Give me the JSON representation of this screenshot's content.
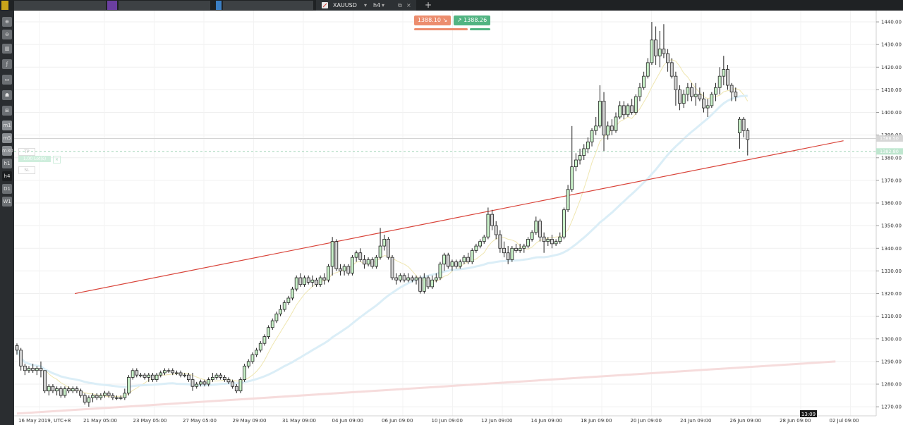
{
  "window": {
    "tab": {
      "symbol": "XAUUSD",
      "timeframe": "h4",
      "new_tab": "+"
    }
  },
  "trade_panel": {
    "sell": {
      "price": "1388.10",
      "arrow": "↘"
    },
    "buy": {
      "price": "1388.26",
      "arrow": "↗"
    }
  },
  "order_lines": {
    "tp_label": "TP",
    "lots_label": "1.00 Lot(s)",
    "sl_label": "SL"
  },
  "toolbar": {
    "buttons": [
      "zoom-in-icon",
      "zoom-out-icon",
      "chart-type-icon",
      "indicator-icon",
      "window-icon",
      "objects-icon",
      "ruler-icon",
      "m1",
      "m5",
      "m30",
      "h1",
      "h4",
      "D1",
      "W1"
    ],
    "active_timeframe": "h4"
  },
  "colors": {
    "bull_body": "#c8f0c8",
    "bear_body": "#d2d2d2",
    "wick": "#222222",
    "trendline": "#d9443a",
    "sell": "#ec8d6e",
    "buy": "#52b482",
    "ma_fast": "#efe6b0",
    "ma_mid": "#dbeef7",
    "ma_slow": "#f6dcdc"
  },
  "chart_data": {
    "type": "candlestick",
    "symbol": "XAUUSD",
    "timeframe": "h4",
    "y_axis": {
      "range": [
        1266,
        1445
      ],
      "ticks": [
        1270,
        1280,
        1290,
        1300,
        1310,
        1320,
        1330,
        1340,
        1350,
        1360,
        1370,
        1380,
        1390,
        1400,
        1410,
        1420,
        1430,
        1440
      ],
      "tick_labels": [
        "1270.00",
        "1280.00",
        "1290.00",
        "1300.00",
        "1310.00",
        "1320.00",
        "1330.00",
        "1340.00",
        "1350.00",
        "1360.00",
        "1370.00",
        "1380.00",
        "1390.00",
        "1400.00",
        "1410.00",
        "1420.00",
        "1430.00",
        "1440.00"
      ]
    },
    "x_axis": {
      "labels": [
        "16 May 2019, UTC+8",
        "21 May 05:00",
        "23 May 05:00",
        "27 May 05:00",
        "29 May 09:00",
        "31 May 09:00",
        "04 Jun 09:00",
        "06 Jun 09:00",
        "10 Jun 09:00",
        "12 Jun 09:00",
        "14 Jun 09:00",
        "18 Jun 09:00",
        "20 Jun 09:00",
        "24 Jun 09:00",
        "26 Jun 09:00",
        "28 Jun 09:00",
        "02 Jul 09:00"
      ],
      "current_time": "13:09"
    },
    "price_markers": {
      "tp_level": 1388.5,
      "current_price": 1382.8,
      "tp_marker_text": "1388.50",
      "current_marker_text": "1382.80"
    },
    "candles": [
      [
        1297.0,
        1298.0,
        1293.0,
        1295.0
      ],
      [
        1295.0,
        1296.0,
        1286.0,
        1288.0
      ],
      [
        1288.0,
        1289.0,
        1284.0,
        1286.0
      ],
      [
        1286.0,
        1288.0,
        1285.0,
        1287.0
      ],
      [
        1287.0,
        1289.0,
        1285.0,
        1286.0
      ],
      [
        1286.0,
        1288.0,
        1284.0,
        1287.0
      ],
      [
        1287.0,
        1290.0,
        1283.0,
        1286.0
      ],
      [
        1286.0,
        1286.0,
        1276.0,
        1277.0
      ],
      [
        1277.0,
        1280.0,
        1275.0,
        1279.0
      ],
      [
        1279.0,
        1280.0,
        1276.0,
        1277.0
      ],
      [
        1277.0,
        1279.0,
        1275.0,
        1278.0
      ],
      [
        1278.0,
        1279.0,
        1274.0,
        1275.0
      ],
      [
        1275.0,
        1279.0,
        1274.0,
        1278.0
      ],
      [
        1278.0,
        1279.0,
        1276.0,
        1277.0
      ],
      [
        1277.0,
        1279.0,
        1276.0,
        1278.0
      ],
      [
        1278.0,
        1279.0,
        1276.0,
        1277.0
      ],
      [
        1277.0,
        1278.0,
        1274.0,
        1275.0
      ],
      [
        1275.0,
        1276.0,
        1271.0,
        1272.0
      ],
      [
        1272.0,
        1275.0,
        1270.0,
        1274.0
      ],
      [
        1274.0,
        1276.0,
        1272.0,
        1275.0
      ],
      [
        1275.0,
        1276.0,
        1273.0,
        1274.0
      ],
      [
        1274.0,
        1276.0,
        1273.0,
        1275.0
      ],
      [
        1275.0,
        1277.0,
        1274.0,
        1276.0
      ],
      [
        1276.0,
        1277.0,
        1274.0,
        1275.0
      ],
      [
        1275.0,
        1276.0,
        1273.0,
        1274.0
      ],
      [
        1274.0,
        1275.0,
        1273.0,
        1274.0
      ],
      [
        1274.0,
        1275.0,
        1273.0,
        1274.0
      ],
      [
        1274.0,
        1278.0,
        1273.0,
        1276.0
      ],
      [
        1276.0,
        1284.0,
        1275.0,
        1283.0
      ],
      [
        1283.0,
        1287.0,
        1282.0,
        1286.0
      ],
      [
        1286.0,
        1287.0,
        1283.0,
        1284.0
      ],
      [
        1284.0,
        1285.0,
        1283.0,
        1284.0
      ],
      [
        1284.0,
        1285.0,
        1282.0,
        1283.0
      ],
      [
        1283.0,
        1285.0,
        1281.0,
        1284.0
      ],
      [
        1284.0,
        1285.0,
        1281.0,
        1282.0
      ],
      [
        1282.0,
        1285.0,
        1281.0,
        1284.0
      ],
      [
        1284.0,
        1286.0,
        1283.0,
        1285.0
      ],
      [
        1285.0,
        1287.0,
        1284.0,
        1286.0
      ],
      [
        1286.0,
        1287.0,
        1285.0,
        1286.0
      ],
      [
        1286.0,
        1287.0,
        1284.0,
        1285.0
      ],
      [
        1285.0,
        1286.0,
        1284.0,
        1285.0
      ],
      [
        1285.0,
        1286.0,
        1283.0,
        1284.0
      ],
      [
        1284.0,
        1285.0,
        1283.0,
        1284.0
      ],
      [
        1284.0,
        1285.0,
        1281.0,
        1282.0
      ],
      [
        1282.0,
        1285.0,
        1277.0,
        1279.0
      ],
      [
        1279.0,
        1281.0,
        1278.0,
        1280.0
      ],
      [
        1280.0,
        1282.0,
        1279.0,
        1281.0
      ],
      [
        1281.0,
        1282.0,
        1279.0,
        1280.0
      ],
      [
        1280.0,
        1283.0,
        1279.0,
        1282.0
      ],
      [
        1282.0,
        1285.0,
        1281.0,
        1283.0
      ],
      [
        1283.0,
        1285.0,
        1282.0,
        1284.0
      ],
      [
        1284.0,
        1285.0,
        1282.0,
        1283.0
      ],
      [
        1283.0,
        1284.0,
        1281.0,
        1282.0
      ],
      [
        1282.0,
        1283.0,
        1280.0,
        1281.0
      ],
      [
        1281.0,
        1282.0,
        1278.0,
        1279.0
      ],
      [
        1279.0,
        1280.0,
        1276.0,
        1277.0
      ],
      [
        1277.0,
        1283.0,
        1276.0,
        1282.0
      ],
      [
        1282.0,
        1289.0,
        1281.0,
        1288.0
      ],
      [
        1288.0,
        1291.0,
        1287.0,
        1290.0
      ],
      [
        1290.0,
        1294.0,
        1289.0,
        1293.0
      ],
      [
        1293.0,
        1296.0,
        1292.0,
        1295.0
      ],
      [
        1295.0,
        1299.0,
        1294.0,
        1298.0
      ],
      [
        1298.0,
        1302.0,
        1297.0,
        1301.0
      ],
      [
        1301.0,
        1306.0,
        1300.0,
        1305.0
      ],
      [
        1305.0,
        1309.0,
        1304.0,
        1308.0
      ],
      [
        1308.0,
        1312.0,
        1307.0,
        1311.0
      ],
      [
        1311.0,
        1315.0,
        1310.0,
        1313.0
      ],
      [
        1313.0,
        1317.0,
        1312.0,
        1316.0
      ],
      [
        1316.0,
        1319.0,
        1315.0,
        1318.0
      ],
      [
        1318.0,
        1323.0,
        1317.0,
        1322.0
      ],
      [
        1322.0,
        1328.0,
        1321.0,
        1327.0
      ],
      [
        1327.0,
        1329.0,
        1323.0,
        1324.0
      ],
      [
        1324.0,
        1328.0,
        1323.0,
        1327.0
      ],
      [
        1327.0,
        1328.0,
        1324.0,
        1325.0
      ],
      [
        1325.0,
        1328.0,
        1323.0,
        1326.0
      ],
      [
        1326.0,
        1327.0,
        1323.0,
        1324.0
      ],
      [
        1324.0,
        1328.0,
        1323.0,
        1327.0
      ],
      [
        1327.0,
        1329.0,
        1324.0,
        1326.0
      ],
      [
        1326.0,
        1333.0,
        1325.0,
        1332.0
      ],
      [
        1332.0,
        1345.0,
        1328.0,
        1343.0
      ],
      [
        1343.0,
        1344.0,
        1330.0,
        1331.0
      ],
      [
        1331.0,
        1333.0,
        1328.0,
        1330.0
      ],
      [
        1330.0,
        1333.0,
        1328.0,
        1332.0
      ],
      [
        1332.0,
        1333.0,
        1328.0,
        1329.0
      ],
      [
        1329.0,
        1337.0,
        1328.0,
        1336.0
      ],
      [
        1336.0,
        1339.0,
        1334.0,
        1338.0
      ],
      [
        1338.0,
        1340.0,
        1334.0,
        1335.0
      ],
      [
        1335.0,
        1337.0,
        1331.0,
        1333.0
      ],
      [
        1333.0,
        1336.0,
        1332.0,
        1335.0
      ],
      [
        1335.0,
        1336.0,
        1331.0,
        1332.0
      ],
      [
        1332.0,
        1337.0,
        1331.0,
        1336.0
      ],
      [
        1336.0,
        1349.0,
        1335.0,
        1341.0
      ],
      [
        1341.0,
        1346.0,
        1339.0,
        1344.0
      ],
      [
        1344.0,
        1345.0,
        1335.0,
        1336.0
      ],
      [
        1336.0,
        1337.0,
        1326.0,
        1327.0
      ],
      [
        1327.0,
        1329.0,
        1324.0,
        1326.0
      ],
      [
        1326.0,
        1329.0,
        1325.0,
        1328.0
      ],
      [
        1328.0,
        1329.0,
        1325.0,
        1326.0
      ],
      [
        1326.0,
        1329.0,
        1325.0,
        1327.0
      ],
      [
        1327.0,
        1328.0,
        1325.0,
        1326.0
      ],
      [
        1326.0,
        1328.0,
        1324.0,
        1327.0
      ],
      [
        1327.0,
        1328.0,
        1320.0,
        1321.0
      ],
      [
        1321.0,
        1329.0,
        1320.0,
        1327.0
      ],
      [
        1327.0,
        1328.0,
        1322.0,
        1323.0
      ],
      [
        1323.0,
        1328.0,
        1322.0,
        1326.0
      ],
      [
        1326.0,
        1329.0,
        1325.0,
        1327.0
      ],
      [
        1327.0,
        1334.0,
        1326.0,
        1333.0
      ],
      [
        1333.0,
        1338.0,
        1330.0,
        1337.0
      ],
      [
        1337.0,
        1338.0,
        1331.0,
        1332.0
      ],
      [
        1332.0,
        1335.0,
        1330.0,
        1334.0
      ],
      [
        1334.0,
        1335.0,
        1331.0,
        1332.0
      ],
      [
        1332.0,
        1335.0,
        1331.0,
        1334.0
      ],
      [
        1334.0,
        1337.0,
        1333.0,
        1336.0
      ],
      [
        1336.0,
        1338.0,
        1333.0,
        1334.0
      ],
      [
        1334.0,
        1340.0,
        1333.0,
        1339.0
      ],
      [
        1339.0,
        1342.0,
        1338.0,
        1341.0
      ],
      [
        1341.0,
        1344.0,
        1340.0,
        1343.0
      ],
      [
        1343.0,
        1346.0,
        1342.0,
        1345.0
      ],
      [
        1345.0,
        1358.0,
        1344.0,
        1355.0
      ],
      [
        1355.0,
        1357.0,
        1348.0,
        1350.0
      ],
      [
        1350.0,
        1352.0,
        1344.0,
        1346.0
      ],
      [
        1346.0,
        1348.0,
        1338.0,
        1340.0
      ],
      [
        1340.0,
        1343.0,
        1336.0,
        1338.0
      ],
      [
        1338.0,
        1341.0,
        1333.0,
        1335.0
      ],
      [
        1335.0,
        1341.0,
        1334.0,
        1340.0
      ],
      [
        1340.0,
        1342.0,
        1338.0,
        1339.0
      ],
      [
        1339.0,
        1342.0,
        1338.0,
        1340.0
      ],
      [
        1340.0,
        1342.0,
        1338.0,
        1341.0
      ],
      [
        1341.0,
        1345.0,
        1340.0,
        1344.0
      ],
      [
        1344.0,
        1348.0,
        1343.0,
        1347.0
      ],
      [
        1347.0,
        1354.0,
        1346.0,
        1352.0
      ],
      [
        1352.0,
        1353.0,
        1343.0,
        1345.0
      ],
      [
        1345.0,
        1347.0,
        1338.0,
        1343.0
      ],
      [
        1343.0,
        1345.0,
        1341.0,
        1344.0
      ],
      [
        1344.0,
        1346.0,
        1340.0,
        1342.0
      ],
      [
        1342.0,
        1344.0,
        1341.0,
        1343.0
      ],
      [
        1343.0,
        1347.0,
        1342.0,
        1345.0
      ],
      [
        1345.0,
        1358.0,
        1344.0,
        1357.0
      ],
      [
        1357.0,
        1368.0,
        1356.0,
        1366.0
      ],
      [
        1366.0,
        1394.0,
        1365.0,
        1376.0
      ],
      [
        1376.0,
        1382.0,
        1374.0,
        1379.0
      ],
      [
        1379.0,
        1384.0,
        1377.0,
        1381.0
      ],
      [
        1381.0,
        1386.0,
        1379.0,
        1384.0
      ],
      [
        1384.0,
        1389.0,
        1382.0,
        1387.0
      ],
      [
        1387.0,
        1393.0,
        1385.0,
        1392.0
      ],
      [
        1392.0,
        1398.0,
        1390.0,
        1394.0
      ],
      [
        1394.0,
        1412.0,
        1393.0,
        1405.0
      ],
      [
        1405.0,
        1409.0,
        1383.0,
        1390.0
      ],
      [
        1390.0,
        1396.0,
        1388.0,
        1394.0
      ],
      [
        1394.0,
        1397.0,
        1390.0,
        1392.0
      ],
      [
        1392.0,
        1400.0,
        1391.0,
        1398.0
      ],
      [
        1398.0,
        1405.0,
        1397.0,
        1403.0
      ],
      [
        1403.0,
        1405.0,
        1397.0,
        1399.0
      ],
      [
        1399.0,
        1404.0,
        1398.0,
        1403.0
      ],
      [
        1403.0,
        1406.0,
        1399.0,
        1400.0
      ],
      [
        1400.0,
        1408.0,
        1399.0,
        1407.0
      ],
      [
        1407.0,
        1413.0,
        1405.0,
        1411.0
      ],
      [
        1411.0,
        1418.0,
        1410.0,
        1416.0
      ],
      [
        1416.0,
        1424.0,
        1415.0,
        1422.0
      ],
      [
        1422.0,
        1440.0,
        1421.0,
        1432.0
      ],
      [
        1432.0,
        1438.0,
        1421.0,
        1425.0
      ],
      [
        1425.0,
        1436.0,
        1420.0,
        1428.0
      ],
      [
        1428.0,
        1439.0,
        1424.0,
        1426.0
      ],
      [
        1426.0,
        1428.0,
        1418.0,
        1422.0
      ],
      [
        1422.0,
        1424.0,
        1415.0,
        1416.0
      ],
      [
        1416.0,
        1418.0,
        1403.0,
        1410.0
      ],
      [
        1410.0,
        1412.0,
        1401.0,
        1404.0
      ],
      [
        1404.0,
        1410.0,
        1402.0,
        1408.0
      ],
      [
        1408.0,
        1413.0,
        1405.0,
        1411.0
      ],
      [
        1411.0,
        1413.0,
        1405.0,
        1407.0
      ],
      [
        1407.0,
        1413.0,
        1403.0,
        1408.0
      ],
      [
        1408.0,
        1411.0,
        1405.0,
        1406.0
      ],
      [
        1406.0,
        1409.0,
        1400.0,
        1402.0
      ],
      [
        1402.0,
        1406.0,
        1398.0,
        1403.0
      ],
      [
        1403.0,
        1409.0,
        1402.0,
        1408.0
      ],
      [
        1408.0,
        1413.0,
        1405.0,
        1411.0
      ],
      [
        1411.0,
        1420.0,
        1408.0,
        1416.0
      ],
      [
        1416.0,
        1425.0,
        1412.0,
        1419.0
      ],
      [
        1419.0,
        1421.0,
        1410.0,
        1412.0
      ],
      [
        1412.0,
        1413.0,
        1405.0,
        1409.0
      ],
      [
        1409.0,
        1411.0,
        1405.0,
        1407.0
      ],
      [
        1391.0,
        1398.0,
        1384.0,
        1397.0
      ],
      [
        1397.0,
        1398.0,
        1389.0,
        1392.0
      ],
      [
        1392.0,
        1393.0,
        1381.0,
        1388.0
      ]
    ],
    "trendline": {
      "from": {
        "index": 14.5,
        "price": 1320.0
      },
      "to": {
        "index": 202.0,
        "price": 1387.5
      }
    }
  }
}
